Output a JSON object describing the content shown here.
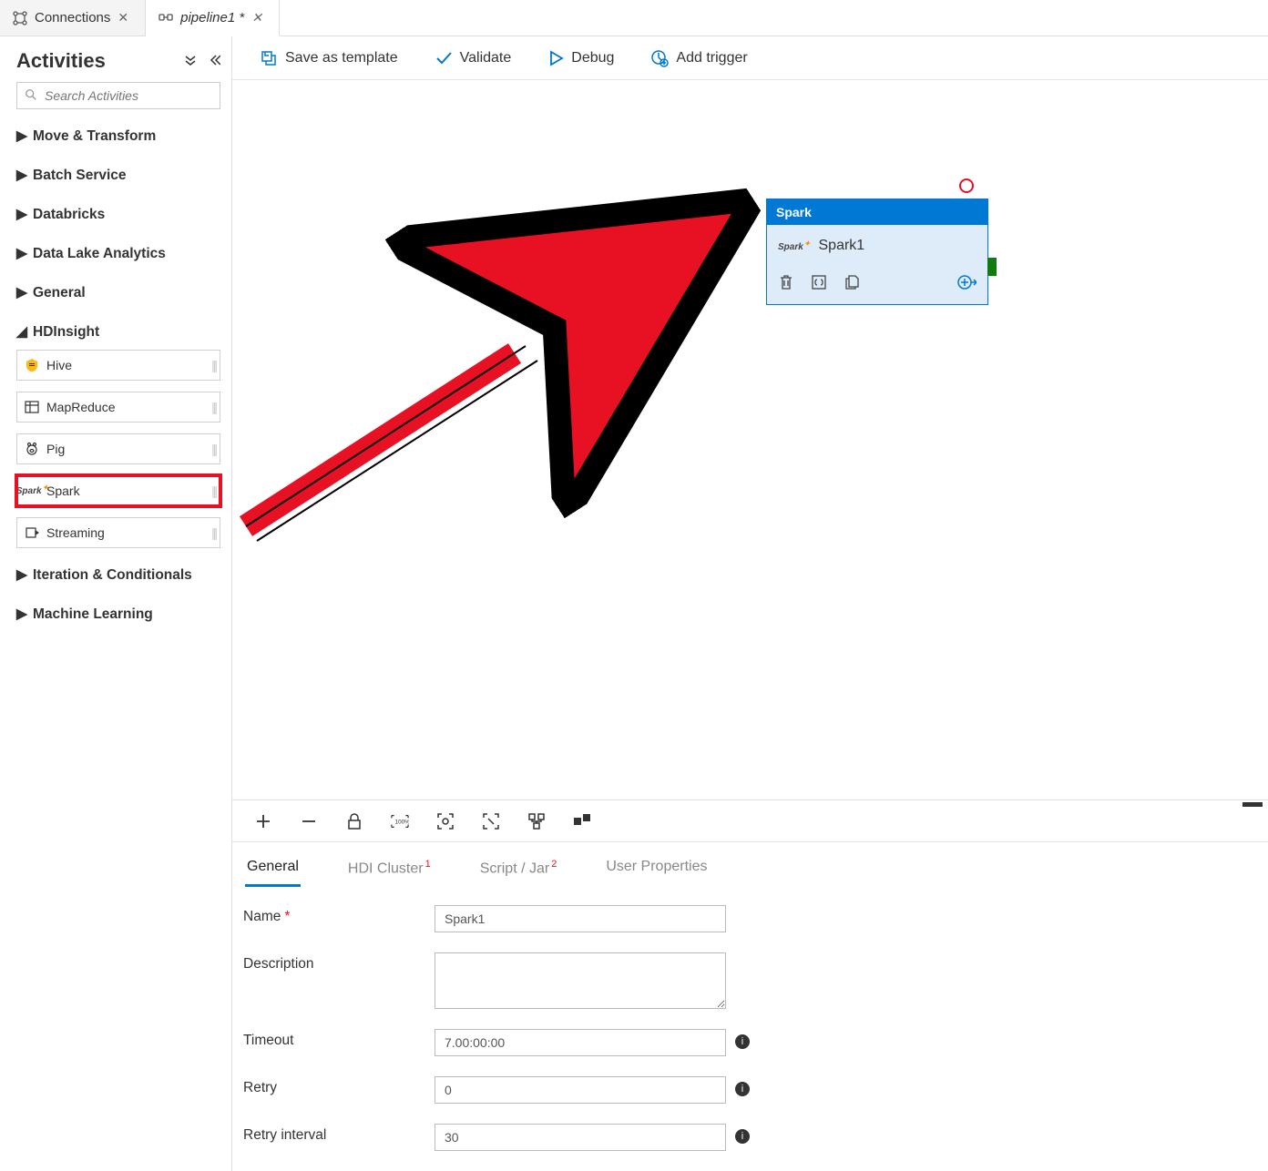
{
  "tabs": [
    {
      "label": "Connections",
      "icon": "connections"
    },
    {
      "label": "pipeline1 *",
      "icon": "pipeline"
    }
  ],
  "sidebar": {
    "title": "Activities",
    "search_placeholder": "Search Activities",
    "groups": [
      {
        "label": "Move & Transform",
        "expanded": false
      },
      {
        "label": "Batch Service",
        "expanded": false
      },
      {
        "label": "Databricks",
        "expanded": false
      },
      {
        "label": "Data Lake Analytics",
        "expanded": false
      },
      {
        "label": "General",
        "expanded": false
      },
      {
        "label": "HDInsight",
        "expanded": true,
        "items": [
          {
            "label": "Hive",
            "icon": "hive"
          },
          {
            "label": "MapReduce",
            "icon": "mapreduce"
          },
          {
            "label": "Pig",
            "icon": "pig"
          },
          {
            "label": "Spark",
            "icon": "spark",
            "highlight": true
          },
          {
            "label": "Streaming",
            "icon": "streaming"
          }
        ]
      },
      {
        "label": "Iteration & Conditionals",
        "expanded": false
      },
      {
        "label": "Machine Learning",
        "expanded": false
      }
    ]
  },
  "toolbar": {
    "save": "Save as template",
    "validate": "Validate",
    "debug": "Debug",
    "trigger": "Add trigger"
  },
  "node": {
    "type": "Spark",
    "name": "Spark1"
  },
  "prop_tabs": {
    "general": "General",
    "hdi": "HDI Cluster",
    "hdi_err": "1",
    "script": "Script / Jar",
    "script_err": "2",
    "user": "User Properties"
  },
  "form": {
    "name_label": "Name",
    "name_value": "Spark1",
    "desc_label": "Description",
    "desc_value": "",
    "timeout_label": "Timeout",
    "timeout_value": "7.00:00:00",
    "retry_label": "Retry",
    "retry_value": "0",
    "retry_int_label": "Retry interval",
    "retry_int_value": "30"
  }
}
